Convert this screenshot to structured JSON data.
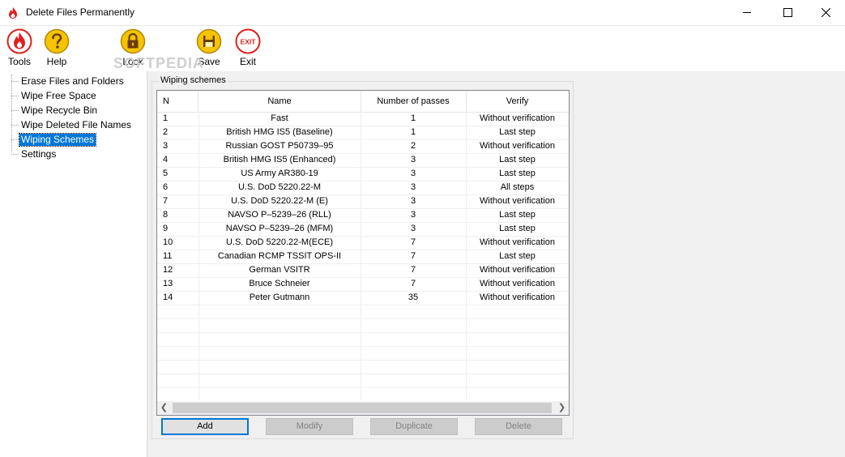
{
  "window": {
    "title": "Delete Files Permanently"
  },
  "toolbar": {
    "tools": "Tools",
    "help": "Help",
    "lock": "Lock",
    "save": "Save",
    "exit": "Exit",
    "exit_icon_text": "EXIT"
  },
  "watermark": "SOFTPEDIA",
  "tree": {
    "items": [
      {
        "label": "Erase Files and Folders"
      },
      {
        "label": "Wipe Free Space"
      },
      {
        "label": "Wipe Recycle Bin"
      },
      {
        "label": "Wipe Deleted File Names"
      },
      {
        "label": "Wiping Schemes",
        "selected": true
      },
      {
        "label": "Settings"
      }
    ]
  },
  "group": {
    "title": "Wiping schemes"
  },
  "table": {
    "headers": {
      "n": "N",
      "name": "Name",
      "passes": "Number of passes",
      "verify": "Verify"
    },
    "rows": [
      {
        "n": "1",
        "name": "Fast",
        "passes": "1",
        "verify": "Without verification"
      },
      {
        "n": "2",
        "name": "British HMG IS5 (Baseline)",
        "passes": "1",
        "verify": "Last step"
      },
      {
        "n": "3",
        "name": "Russian GOST P50739–95",
        "passes": "2",
        "verify": "Without verification"
      },
      {
        "n": "4",
        "name": "British HMG IS5 (Enhanced)",
        "passes": "3",
        "verify": "Last step"
      },
      {
        "n": "5",
        "name": "US Army AR380-19",
        "passes": "3",
        "verify": "Last step"
      },
      {
        "n": "6",
        "name": "U.S. DoD 5220.22-M",
        "passes": "3",
        "verify": "All steps"
      },
      {
        "n": "7",
        "name": "U.S. DoD 5220.22-M (E)",
        "passes": "3",
        "verify": "Without verification"
      },
      {
        "n": "8",
        "name": "NAVSO P–5239–26 (RLL)",
        "passes": "3",
        "verify": "Last step"
      },
      {
        "n": "9",
        "name": "NAVSO P–5239–26 (MFM)",
        "passes": "3",
        "verify": "Last step"
      },
      {
        "n": "10",
        "name": "U.S. DoD 5220.22-M(ECE)",
        "passes": "7",
        "verify": "Without verification"
      },
      {
        "n": "11",
        "name": "Canadian RCMP TSSIT OPS-II",
        "passes": "7",
        "verify": "Last step"
      },
      {
        "n": "12",
        "name": "German VSITR",
        "passes": "7",
        "verify": "Without verification"
      },
      {
        "n": "13",
        "name": "Bruce Schneier",
        "passes": "7",
        "verify": "Without verification"
      },
      {
        "n": "14",
        "name": "Peter Gutmann",
        "passes": "35",
        "verify": "Without verification"
      }
    ]
  },
  "buttons": {
    "add": "Add",
    "modify": "Modify",
    "duplicate": "Duplicate",
    "delete": "Delete"
  },
  "colors": {
    "accent": "#0078d7",
    "icon_red": "#e02020",
    "icon_yellow": "#f5c400"
  }
}
